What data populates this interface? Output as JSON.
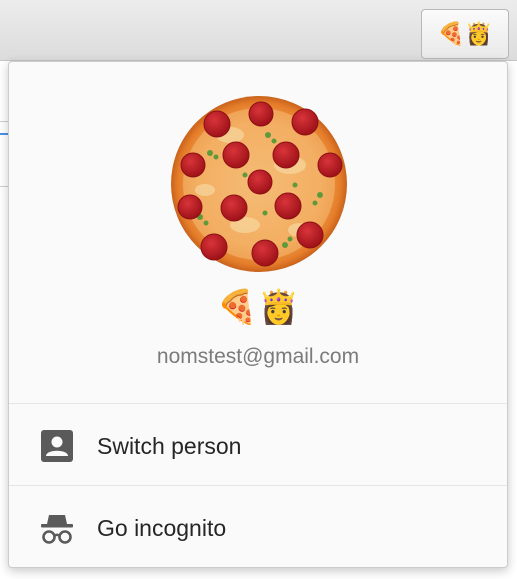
{
  "toolbar": {
    "avatar_button_emoji": "🍕👸",
    "avatar_button_icon": "profile-avatar-icon"
  },
  "profile": {
    "avatar_image": "pepperoni-pizza",
    "name": "🍕👸",
    "email": "nomstest@gmail.com"
  },
  "menu": {
    "items": [
      {
        "label": "Switch person",
        "icon": "person-card-icon"
      },
      {
        "label": "Go incognito",
        "icon": "incognito-icon"
      }
    ]
  },
  "colors": {
    "popup_background": "#fafafa",
    "email_text": "#7b7b7b",
    "menu_text": "#262626",
    "icon_gray": "#5a5a5a",
    "pepperoni": "#b3191f",
    "crust": "#e8822c"
  }
}
